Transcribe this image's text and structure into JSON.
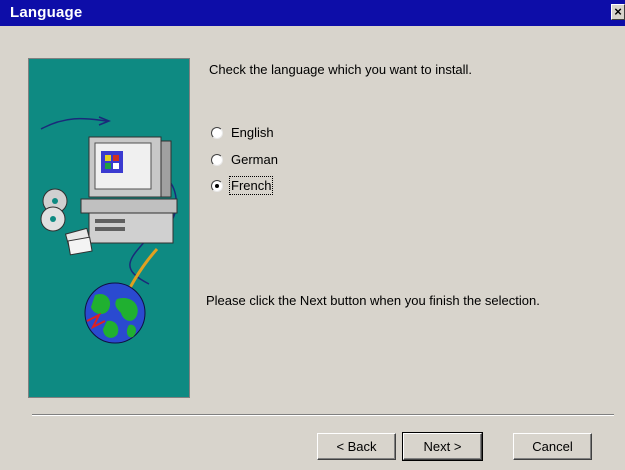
{
  "window": {
    "title": "Language",
    "close_label": "×"
  },
  "main": {
    "prompt": "Check the language which you want to install.",
    "options": [
      {
        "label": "English",
        "selected": false
      },
      {
        "label": "German",
        "selected": false
      },
      {
        "label": "French",
        "selected": true
      }
    ],
    "hint": "Please click the Next button when you finish the selection."
  },
  "buttons": {
    "back_label": "< Back",
    "next_label": "Next >",
    "cancel_label": "Cancel"
  },
  "colors": {
    "title_bar": "#0d0da8",
    "panel_background": "#0e8a82",
    "dialog_background": "#d8d4cc"
  },
  "icons": [
    "computer-illustration",
    "cd-icon",
    "globe-icon"
  ]
}
